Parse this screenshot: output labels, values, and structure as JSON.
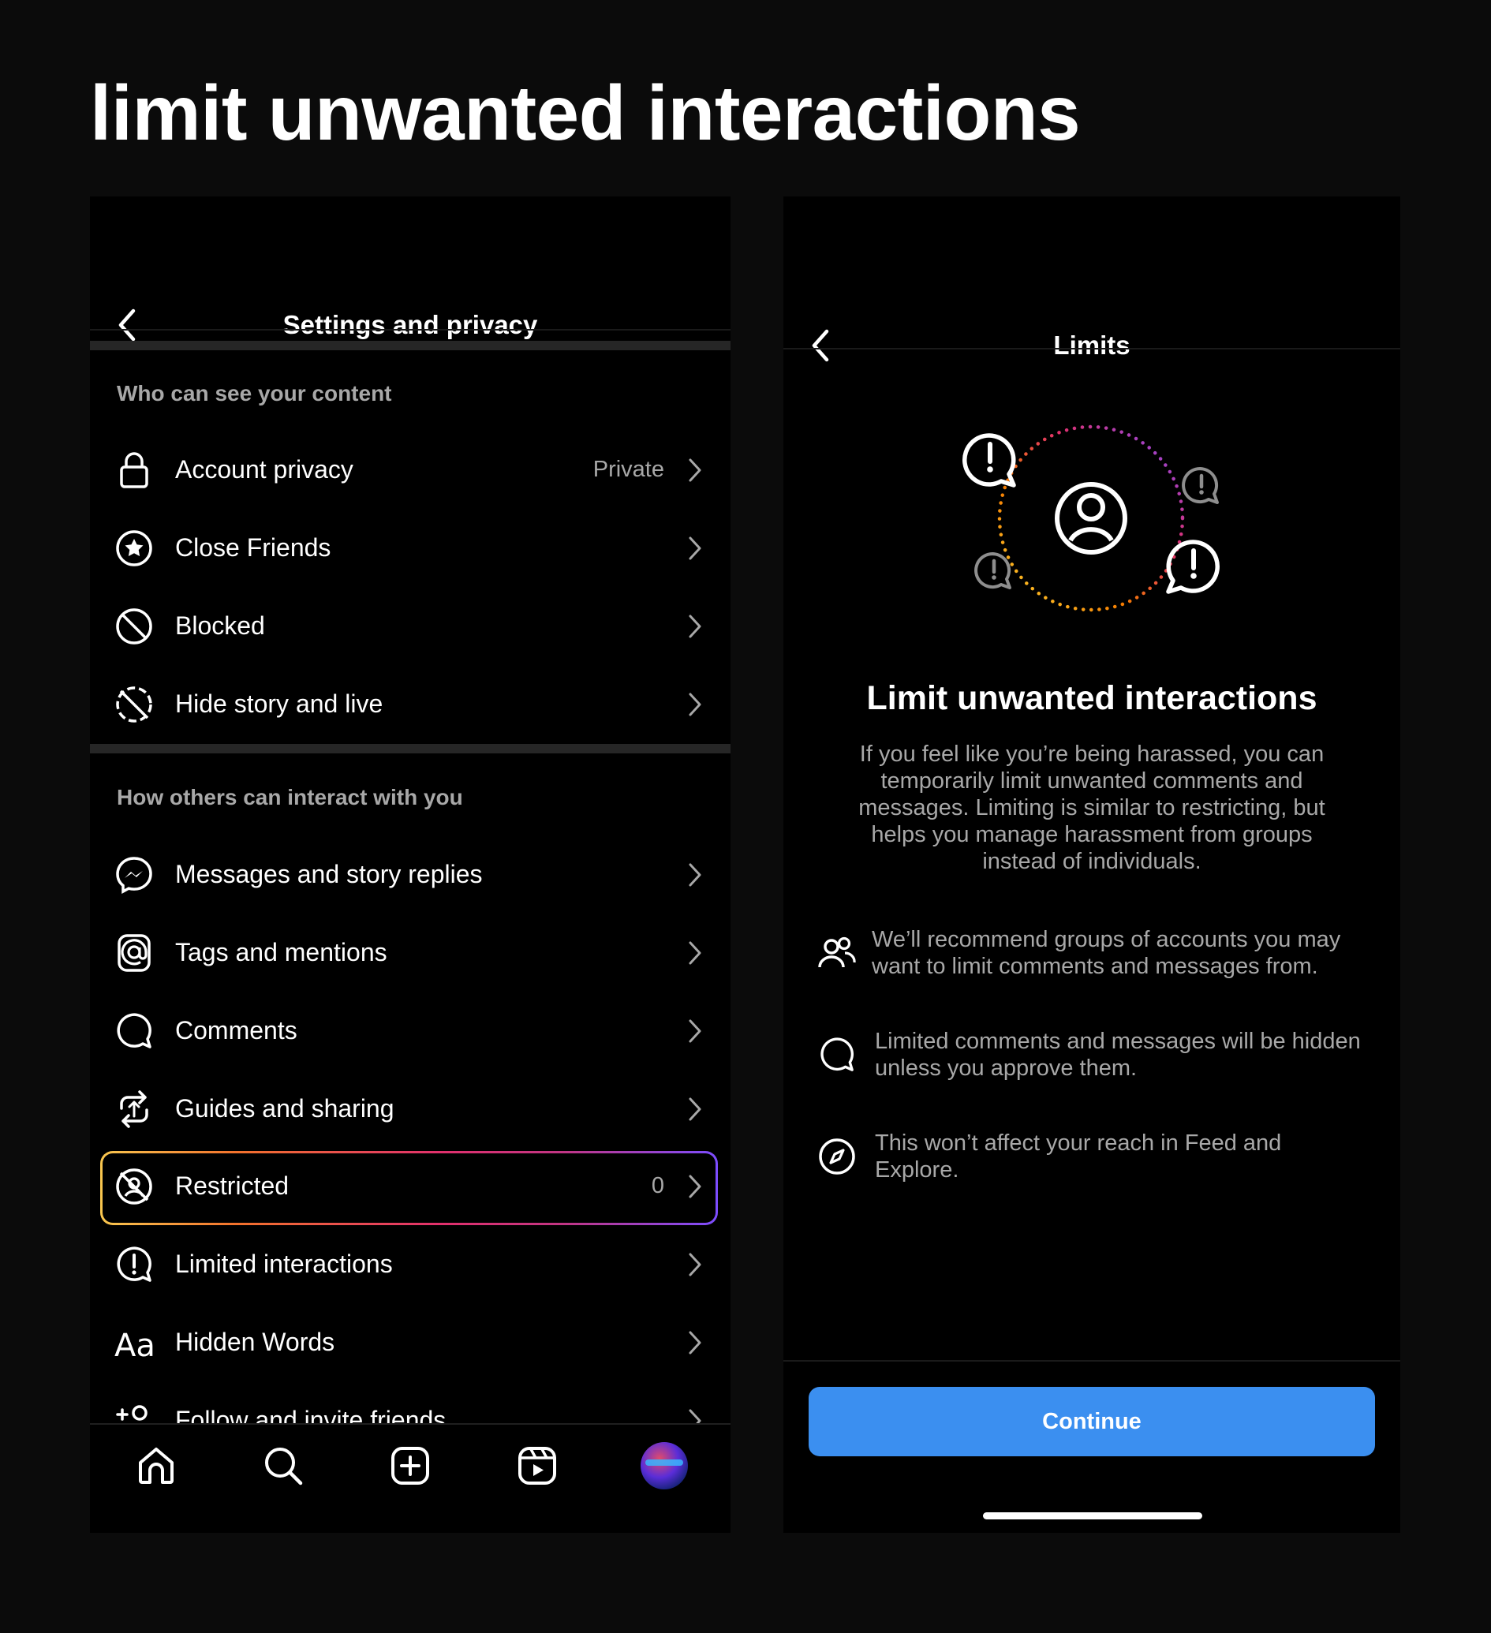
{
  "page": {
    "title": "limit unwanted interactions"
  },
  "left_phone": {
    "nav": {
      "title": "Settings and privacy",
      "back_icon": "chevron-left-icon"
    },
    "section1": {
      "header": "Who can see your content",
      "items": [
        {
          "label": "Account privacy",
          "value": "Private",
          "icon": "lock-icon"
        },
        {
          "label": "Close Friends",
          "value": "",
          "icon": "star-circle-icon"
        },
        {
          "label": "Blocked",
          "value": "",
          "icon": "blocked-icon"
        },
        {
          "label": "Hide story and live",
          "value": "",
          "icon": "hide-story-icon"
        }
      ]
    },
    "section2": {
      "header": "How others can interact with you",
      "items": [
        {
          "label": "Messages and story replies",
          "value": "",
          "icon": "messenger-icon"
        },
        {
          "label": "Tags and mentions",
          "value": "",
          "icon": "at-icon"
        },
        {
          "label": "Comments",
          "value": "",
          "icon": "comment-icon"
        },
        {
          "label": "Guides and sharing",
          "value": "",
          "icon": "share-icon"
        },
        {
          "label": "Restricted",
          "value": "0",
          "icon": "restricted-icon"
        },
        {
          "label": "Limited interactions",
          "value": "",
          "icon": "alert-circle-icon"
        },
        {
          "label": "Hidden Words",
          "value": "",
          "icon": "text-aa-icon"
        },
        {
          "label": "Follow and invite friends",
          "value": "",
          "icon": "add-person-icon"
        }
      ]
    },
    "tabbar": [
      "home-icon",
      "search-icon",
      "create-icon",
      "reels-icon",
      "profile-avatar"
    ]
  },
  "right_phone": {
    "nav": {
      "title": "Limits",
      "back_icon": "chevron-left-icon"
    },
    "heading": "Limit unwanted interactions",
    "description": "If you feel like you’re being harassed, you can temporarily limit unwanted comments and messages. Limiting is similar to restricting, but helps you manage harassment from groups instead of individuals.",
    "bullets": [
      {
        "text": "We’ll recommend groups of accounts you may want to limit comments and messages from.",
        "icon": "people-icon"
      },
      {
        "text": "Limited comments and messages will be hidden unless you approve them.",
        "icon": "comment-icon"
      },
      {
        "text": "This won’t affect your reach in Feed and Explore.",
        "icon": "compass-icon"
      }
    ],
    "continue_label": "Continue"
  },
  "colors": {
    "accent_blue": "#3b8ff0",
    "background": "#0b0b0b",
    "secondary_text": "#a8a8a8"
  }
}
